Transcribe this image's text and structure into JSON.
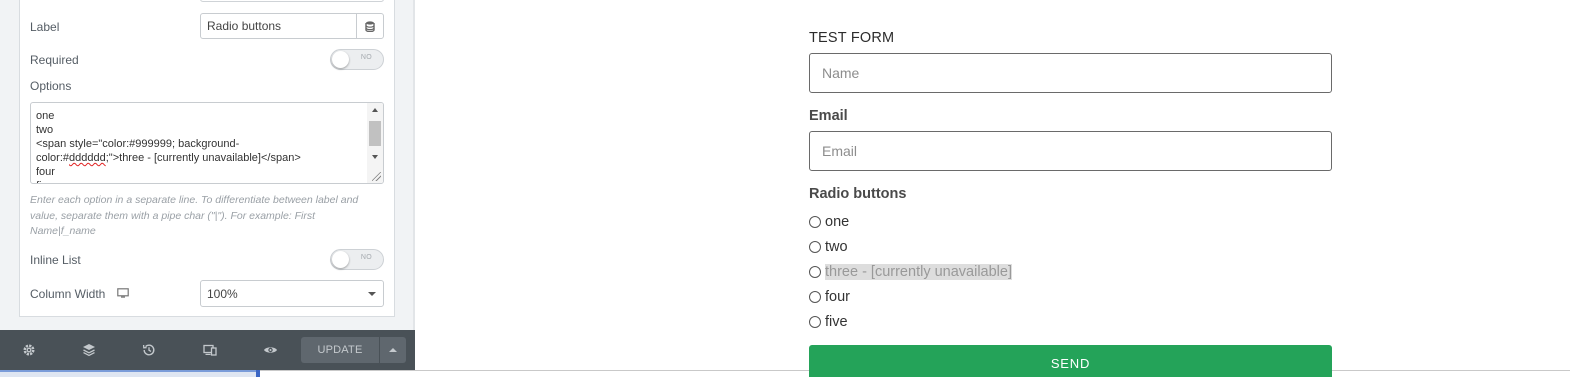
{
  "editor": {
    "label_field": {
      "label": "Label",
      "value": "Radio buttons"
    },
    "required": {
      "label": "Required",
      "toggle_text": "NO"
    },
    "options": {
      "label": "Options",
      "lines": [
        "one",
        "two",
        "<span style=\"color:#999999; background-",
        "color:#dddddd;\">three - [currently unavailable]</span>",
        "four",
        "five"
      ],
      "help": "Enter each option in a separate line. To differentiate between label and value, separate them with a pipe char (\"|\"). For example: First Name|f_name"
    },
    "inline_list": {
      "label": "Inline List",
      "toggle_text": "NO"
    },
    "column_width": {
      "label": "Column Width",
      "value": "100%"
    }
  },
  "toolbar": {
    "icons": [
      "settings-icon",
      "layers-icon",
      "history-icon",
      "responsive-icon",
      "preview-eye-icon"
    ],
    "update_label": "UPDATE"
  },
  "form": {
    "heading": "TEST FORM",
    "name_placeholder": "Name",
    "email_label": "Email",
    "email_placeholder": "Email",
    "radio_label": "Radio buttons",
    "radio_options": [
      "one",
      "two",
      "three - [currently unavailable]",
      "four",
      "five"
    ],
    "unavailable_text_color": "#999999",
    "unavailable_bg_color": "#dddddd",
    "send_label": "SEND",
    "send_color": "#24a359"
  }
}
